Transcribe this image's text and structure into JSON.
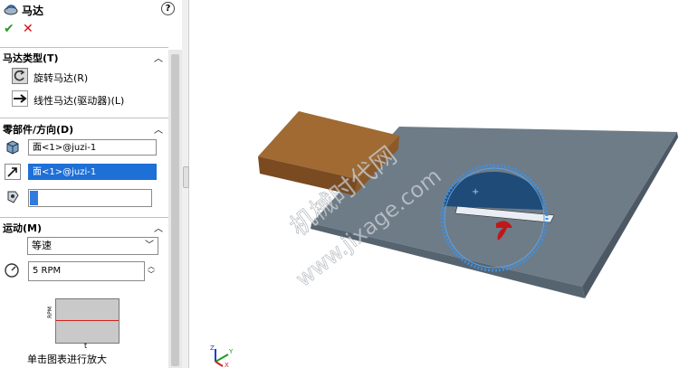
{
  "panel": {
    "title": "马达",
    "help": "?",
    "ok_symbol": "✔",
    "cancel_symbol": "✕"
  },
  "motor_type": {
    "title": "马达类型(T)",
    "options": [
      {
        "label": "旋转马达(R)",
        "icon": "rotary-motor-icon",
        "selected": true
      },
      {
        "label": "线性马达(驱动器)(L)",
        "icon": "linear-motor-icon",
        "selected": false
      }
    ]
  },
  "component_direction": {
    "title": "零部件/方向(D)",
    "location_value": "面<1>@juzi-1",
    "direction_value": "面<1>@juzi-1",
    "component_value": ""
  },
  "motion": {
    "title": "运动(M)",
    "type_value": "等速",
    "speed_value": "5 RPM",
    "graph_ylabel": "RPM",
    "graph_xlabel": "t",
    "hint": "单击图表进行放大"
  },
  "viewport": {
    "watermark_line1": "机械时代网",
    "watermark_line2": "www.jixage.com",
    "axis_x": "X",
    "axis_y": "Y",
    "axis_z": "Z"
  },
  "colors": {
    "selection": "#1e6fd6",
    "plate": "#6e7c88",
    "blade": "#1f4b78",
    "wood": "#a06a32",
    "highlight": "#3d8fe0"
  }
}
